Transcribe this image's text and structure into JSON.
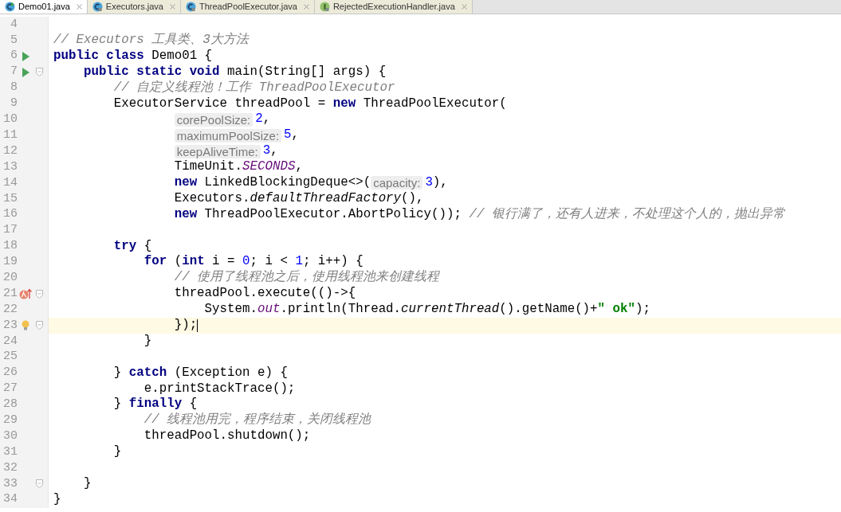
{
  "tabs": [
    {
      "label": "Demo01.java",
      "kind": "class-runnable",
      "selected": true
    },
    {
      "label": "Executors.java",
      "kind": "class-locked",
      "selected": false
    },
    {
      "label": "ThreadPoolExecutor.java",
      "kind": "class-locked",
      "selected": false
    },
    {
      "label": "RejectedExecutionHandler.java",
      "kind": "interface-locked",
      "selected": false
    }
  ],
  "lines": [
    {
      "number": "4",
      "fold": false,
      "current": false
    },
    {
      "number": "5",
      "fold": false,
      "current": false,
      "continuation": false,
      "tokens": [
        {
          "kind": "comment",
          "text": "// Executors 工具类、3大方法"
        }
      ]
    },
    {
      "number": "6",
      "gutter": {
        "kind": "run"
      },
      "fold": false,
      "current": false,
      "continuation": false,
      "tokens": [
        {
          "kind": "kw",
          "text": "public class "
        },
        {
          "kind": "plain",
          "text": "Demo01 {"
        }
      ]
    },
    {
      "number": "7",
      "gutter": {
        "kind": "run"
      },
      "fold": true,
      "current": false,
      "continuation": false,
      "tokens": [
        {
          "kind": "kw",
          "text": "    public static void "
        },
        {
          "kind": "plain",
          "text": "main(String[] args) {"
        }
      ]
    },
    {
      "number": "8",
      "fold": false,
      "current": false,
      "continuation": false,
      "tokens": [
        {
          "kind": "comment",
          "text": "        // 自定义线程池！工作 ThreadPoolExecutor"
        }
      ]
    },
    {
      "number": "9",
      "fold": false,
      "current": false,
      "continuation": false,
      "tokens": [
        {
          "kind": "plain",
          "text": "        ExecutorService threadPool = "
        },
        {
          "kind": "kw",
          "text": "new "
        },
        {
          "kind": "plain",
          "text": "ThreadPoolExecutor("
        }
      ]
    },
    {
      "number": "10",
      "fold": false,
      "current": false,
      "continuation": true,
      "tokens": [
        {
          "kind": "hint",
          "text": "corePoolSize:"
        },
        {
          "kind": "num",
          "text": "2"
        },
        {
          "kind": "plain",
          "text": ","
        }
      ]
    },
    {
      "number": "11",
      "fold": false,
      "current": false,
      "continuation": true,
      "tokens": [
        {
          "kind": "hint",
          "text": "maximumPoolSize:"
        },
        {
          "kind": "num",
          "text": "5"
        },
        {
          "kind": "plain",
          "text": ","
        }
      ]
    },
    {
      "number": "12",
      "fold": false,
      "current": false,
      "continuation": true,
      "tokens": [
        {
          "kind": "hint",
          "text": "keepAliveTime:"
        },
        {
          "kind": "num",
          "text": "3"
        },
        {
          "kind": "plain",
          "text": ","
        }
      ]
    },
    {
      "number": "13",
      "fold": false,
      "current": false,
      "continuation": true,
      "tokens": [
        {
          "kind": "plain",
          "text": "TimeUnit."
        },
        {
          "kind": "field",
          "text": "SECONDS"
        },
        {
          "kind": "plain",
          "text": ","
        }
      ]
    },
    {
      "number": "14",
      "fold": false,
      "current": false,
      "continuation": true,
      "tokens": [
        {
          "kind": "kw",
          "text": "new "
        },
        {
          "kind": "plain",
          "text": "LinkedBlockingDeque<>("
        },
        {
          "kind": "hint",
          "text": "capacity:"
        },
        {
          "kind": "num",
          "text": "3"
        },
        {
          "kind": "plain",
          "text": "),"
        }
      ]
    },
    {
      "number": "15",
      "fold": false,
      "current": false,
      "continuation": true,
      "tokens": [
        {
          "kind": "plain",
          "text": "Executors."
        },
        {
          "kind": "method",
          "text": "defaultThreadFactory"
        },
        {
          "kind": "plain",
          "text": "(),"
        }
      ]
    },
    {
      "number": "16",
      "fold": false,
      "current": false,
      "continuation": true,
      "tokens": [
        {
          "kind": "kw",
          "text": "new "
        },
        {
          "kind": "plain",
          "text": "ThreadPoolExecutor.AbortPolicy()); "
        },
        {
          "kind": "comment",
          "text": "// 银行满了，还有人进来，不处理这个人的，抛出异常"
        }
      ]
    },
    {
      "number": "17",
      "fold": false,
      "current": false
    },
    {
      "number": "18",
      "fold": false,
      "current": false,
      "continuation": false,
      "tokens": [
        {
          "kind": "kw",
          "text": "        try "
        },
        {
          "kind": "plain",
          "text": "{"
        }
      ]
    },
    {
      "number": "19",
      "fold": false,
      "current": false,
      "continuation": false,
      "tokens": [
        {
          "kind": "kw",
          "text": "            for "
        },
        {
          "kind": "plain",
          "text": "("
        },
        {
          "kind": "kw",
          "text": "int "
        },
        {
          "kind": "plain",
          "text": "i = "
        },
        {
          "kind": "num",
          "text": "0"
        },
        {
          "kind": "plain",
          "text": "; i < "
        },
        {
          "kind": "num",
          "text": "1"
        },
        {
          "kind": "plain",
          "text": "; i++) {"
        }
      ]
    },
    {
      "number": "20",
      "fold": false,
      "current": false,
      "continuation": false,
      "tokens": [
        {
          "kind": "comment",
          "text": "                // 使用了线程池之后，使用线程池来创建线程"
        }
      ]
    },
    {
      "number": "21",
      "gutter": {
        "kind": "lambda"
      },
      "fold": true,
      "current": false,
      "continuation": false,
      "tokens": [
        {
          "kind": "plain",
          "text": "                threadPool.execute(()->{"
        }
      ]
    },
    {
      "number": "22",
      "fold": false,
      "current": false,
      "continuation": false,
      "tokens": [
        {
          "kind": "plain",
          "text": "                    System."
        },
        {
          "kind": "field",
          "text": "out"
        },
        {
          "kind": "plain",
          "text": ".println(Thread."
        },
        {
          "kind": "method",
          "text": "currentThread"
        },
        {
          "kind": "plain",
          "text": "().getName()+"
        },
        {
          "kind": "str",
          "text": "\" ok\""
        },
        {
          "kind": "plain",
          "text": ");"
        }
      ]
    },
    {
      "number": "23",
      "gutter": {
        "kind": "bulb"
      },
      "fold": true,
      "current": true,
      "continuation": false,
      "tokens": [
        {
          "kind": "plain",
          "text": "                });"
        }
      ]
    },
    {
      "number": "24",
      "fold": false,
      "current": false,
      "continuation": false,
      "tokens": [
        {
          "kind": "plain",
          "text": "            }"
        }
      ]
    },
    {
      "number": "25",
      "fold": false,
      "current": false
    },
    {
      "number": "26",
      "fold": false,
      "current": false,
      "continuation": false,
      "tokens": [
        {
          "kind": "plain",
          "text": "        } "
        },
        {
          "kind": "kw",
          "text": "catch "
        },
        {
          "kind": "plain",
          "text": "(Exception e) {"
        }
      ]
    },
    {
      "number": "27",
      "fold": false,
      "current": false,
      "continuation": false,
      "tokens": [
        {
          "kind": "plain",
          "text": "            e.printStackTrace();"
        }
      ]
    },
    {
      "number": "28",
      "fold": false,
      "current": false,
      "continuation": false,
      "tokens": [
        {
          "kind": "plain",
          "text": "        } "
        },
        {
          "kind": "kw",
          "text": "finally "
        },
        {
          "kind": "plain",
          "text": "{"
        }
      ]
    },
    {
      "number": "29",
      "fold": false,
      "current": false,
      "continuation": false,
      "tokens": [
        {
          "kind": "comment",
          "text": "            // 线程池用完，程序结束，关闭线程池"
        }
      ]
    },
    {
      "number": "30",
      "fold": false,
      "current": false,
      "continuation": false,
      "tokens": [
        {
          "kind": "plain",
          "text": "            threadPool.shutdown();"
        }
      ]
    },
    {
      "number": "31",
      "fold": false,
      "current": false,
      "continuation": false,
      "tokens": [
        {
          "kind": "plain",
          "text": "        }"
        }
      ]
    },
    {
      "number": "32",
      "fold": false,
      "current": false
    },
    {
      "number": "33",
      "fold": true,
      "current": false,
      "continuation": false,
      "tokens": [
        {
          "kind": "plain",
          "text": "    }"
        }
      ]
    },
    {
      "number": "34",
      "fold": false,
      "current": false,
      "continuation": false,
      "tokens": [
        {
          "kind": "plain",
          "text": "}"
        }
      ]
    }
  ]
}
